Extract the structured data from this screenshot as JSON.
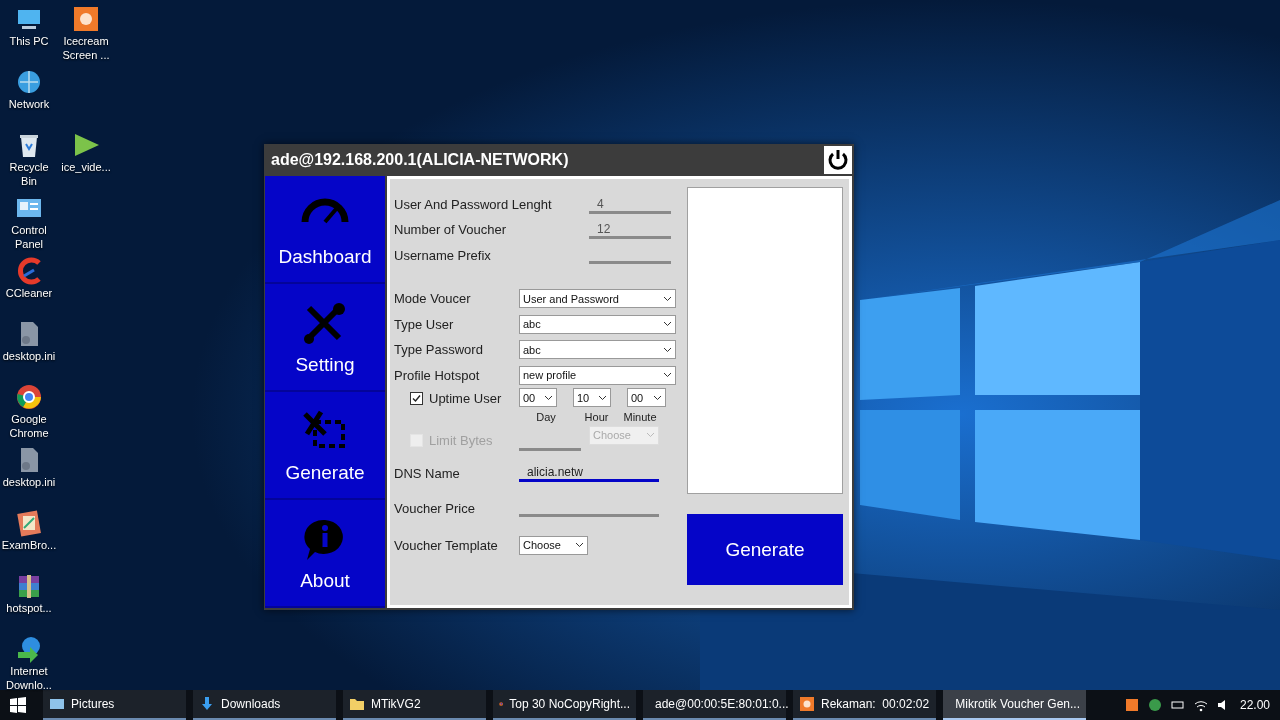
{
  "desktop_icon_columns": [
    {
      "icons": [
        {
          "label": "This PC",
          "kind": "pc"
        },
        {
          "label": "Network",
          "kind": "network"
        },
        {
          "label": "Recycle Bin",
          "kind": "recycle"
        },
        {
          "label": "Control Panel",
          "kind": "control"
        },
        {
          "label": "CCleaner",
          "kind": "cleaner"
        },
        {
          "label": "desktop.ini",
          "kind": "file"
        },
        {
          "label": "Google Chrome",
          "kind": "browser"
        },
        {
          "label": "desktop.ini",
          "kind": "file"
        },
        {
          "label": "ExamBro...",
          "kind": "exam"
        },
        {
          "label": "hotspot...",
          "kind": "archive"
        },
        {
          "label": "Internet Downlo...",
          "kind": "download"
        }
      ]
    },
    {
      "icons": [
        {
          "label": "Icecream Screen ...",
          "kind": "recorder"
        },
        {
          "label": "ice_vide...",
          "kind": "video"
        }
      ]
    }
  ],
  "window": {
    "title": "ade@192.168.200.1(ALICIA-NETWORK)"
  },
  "sidebar": {
    "items": [
      {
        "label": "Dashboard",
        "kind": "dashboard"
      },
      {
        "label": "Setting",
        "kind": "setting"
      },
      {
        "label": "Generate",
        "kind": "generate"
      },
      {
        "label": "About",
        "kind": "about"
      }
    ]
  },
  "form": {
    "fields": [
      {
        "kind": "number",
        "label": "User And Password Lenght",
        "value": "4"
      },
      {
        "kind": "number",
        "label": "Number of Voucher",
        "value": "12"
      },
      {
        "kind": "number",
        "label": "Username Prefix"
      },
      {
        "kind": "select",
        "label": "Mode Voucer",
        "value": "User and Password"
      },
      {
        "kind": "select",
        "label": "Type User",
        "value": "abc"
      },
      {
        "kind": "select",
        "label": "Type Password",
        "value": "abc"
      },
      {
        "kind": "select",
        "label": "Profile Hotspot",
        "value": "new profile"
      },
      {
        "kind": "time",
        "label": "Uptime User",
        "checked": true,
        "parts": [
          {
            "value": "00",
            "unit": "Day"
          },
          {
            "value": "10",
            "unit": "Hour"
          },
          {
            "value": "00",
            "unit": "Minute"
          }
        ]
      },
      {
        "kind": "limit",
        "label": "Limit Bytes",
        "checked": false,
        "disabled": true,
        "choice": "Choose"
      },
      {
        "kind": "text",
        "label": "DNS Name",
        "value": "alicia.netw",
        "focused": true
      },
      {
        "kind": "text",
        "label": "Voucher Price",
        "focused": false
      },
      {
        "kind": "template",
        "label": "Voucher Template",
        "value": "Choose"
      }
    ]
  },
  "generate_button": "Generate",
  "taskbar": {
    "items": [
      {
        "label": "Pictures",
        "kind": "pictures",
        "selected": false
      },
      {
        "label": "Downloads",
        "kind": "downloads",
        "selected": false
      },
      {
        "label": "MTikVG2",
        "kind": "folder",
        "selected": false
      },
      {
        "label": "Top 30 NoCopyRight...",
        "kind": "firefox",
        "selected": false
      },
      {
        "label": "ade@00:00:5E:80:01:0...",
        "kind": "globe",
        "selected": false
      },
      {
        "label": "Rekaman:  00:02:02",
        "kind": "recorder",
        "selected": false
      },
      {
        "label": "Mikrotik Voucher Gen...",
        "kind": "app",
        "selected": true
      }
    ],
    "clock": "22.00"
  }
}
